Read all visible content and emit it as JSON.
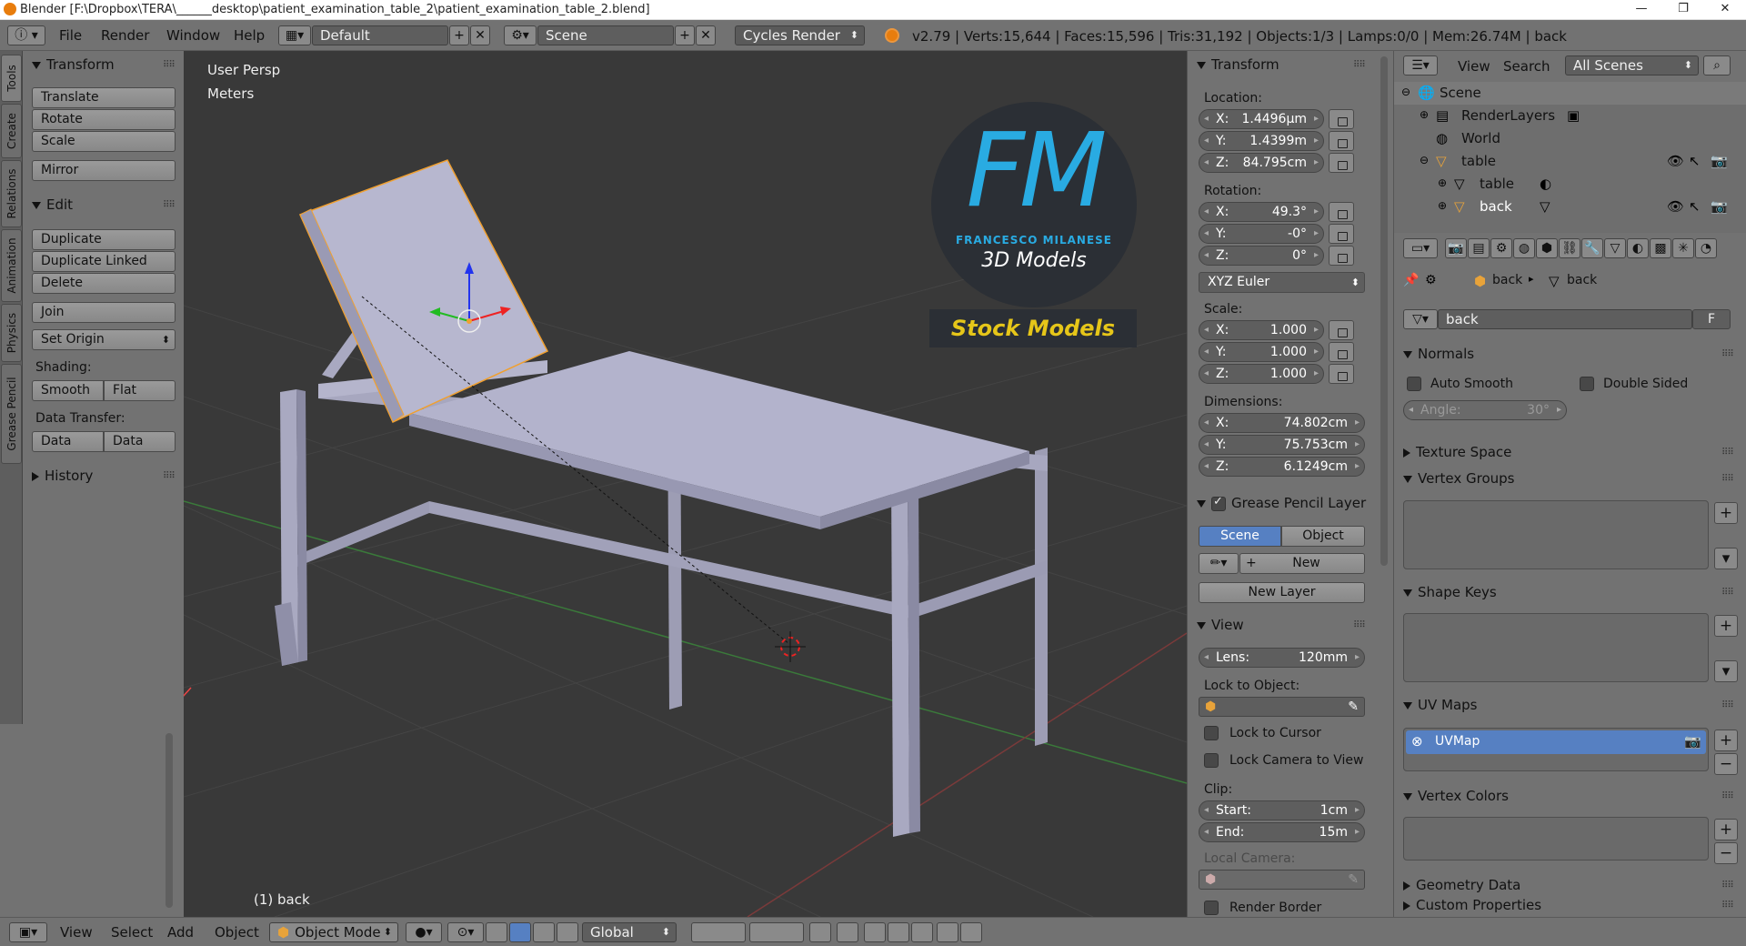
{
  "window": {
    "title": "Blender [F:\\Dropbox\\TERA\\______desktop\\patient_examination_table_2\\patient_examination_table_2.blend]"
  },
  "info": {
    "menus": [
      "File",
      "Render",
      "Window",
      "Help"
    ],
    "screen": "Default",
    "scene": "Scene",
    "engine": "Cycles Render",
    "stats": "v2.79 | Verts:15,644 | Faces:15,596 | Tris:31,192 | Objects:1/3 | Lamps:0/0 | Mem:26.74M | back"
  },
  "tabs": [
    "Tools",
    "Create",
    "Relations",
    "Animation",
    "Physics",
    "Grease Pencil"
  ],
  "toolshelf": {
    "transform_title": "Transform",
    "translate": "Translate",
    "rotate": "Rotate",
    "scale": "Scale",
    "mirror": "Mirror",
    "edit_title": "Edit",
    "duplicate": "Duplicate",
    "duplicate_linked": "Duplicate Linked",
    "delete": "Delete",
    "join": "Join",
    "set_origin": "Set Origin",
    "shading": "Shading:",
    "smooth": "Smooth",
    "flat": "Flat",
    "data_transfer": "Data Transfer:",
    "data": "Data",
    "data_layout": "Data Layo",
    "history": "History"
  },
  "viewport": {
    "view_name": "User Persp",
    "units": "Meters",
    "object_label": "(1) back",
    "watermark": {
      "letters": "FM",
      "author": "FRANCESCO MILANESE",
      "sub": "3D Models",
      "badge": "Stock Models"
    }
  },
  "npanel": {
    "transform_title": "Transform",
    "location_label": "Location:",
    "loc": [
      {
        "k": "X:",
        "v": "1.4496µm"
      },
      {
        "k": "Y:",
        "v": "1.4399m"
      },
      {
        "k": "Z:",
        "v": "84.795cm"
      }
    ],
    "rotation_label": "Rotation:",
    "rot": [
      {
        "k": "X:",
        "v": "49.3°"
      },
      {
        "k": "Y:",
        "v": "-0°"
      },
      {
        "k": "Z:",
        "v": "0°"
      }
    ],
    "rotation_mode": "XYZ Euler",
    "scale_label": "Scale:",
    "scale": [
      {
        "k": "X:",
        "v": "1.000"
      },
      {
        "k": "Y:",
        "v": "1.000"
      },
      {
        "k": "Z:",
        "v": "1.000"
      }
    ],
    "dimensions_label": "Dimensions:",
    "dim": [
      {
        "k": "X:",
        "v": "74.802cm"
      },
      {
        "k": "Y:",
        "v": "75.753cm"
      },
      {
        "k": "Z:",
        "v": "6.1249cm"
      }
    ],
    "gp_title": "Grease Pencil Layer",
    "gp_scene": "Scene",
    "gp_object": "Object",
    "gp_new": "New",
    "gp_new_layer": "New Layer",
    "view_title": "View",
    "lens_k": "Lens:",
    "lens_v": "120mm",
    "lock_to_object": "Lock to Object:",
    "lock_cursor": "Lock to Cursor",
    "lock_camera": "Lock Camera to View",
    "clip": "Clip:",
    "start_k": "Start:",
    "start_v": "1cm",
    "end_k": "End:",
    "end_v": "15m",
    "local_camera": "Local Camera:",
    "render_border": "Render Border"
  },
  "outliner": {
    "view": "View",
    "search": "Search",
    "filter": "All Scenes",
    "rows": [
      {
        "name": "Scene"
      },
      {
        "name": "RenderLayers"
      },
      {
        "name": "World"
      },
      {
        "name": "table"
      },
      {
        "name": "table"
      },
      {
        "name": "back"
      }
    ]
  },
  "props": {
    "crumb_object": "back",
    "crumb_mesh": "back",
    "mesh_name": "back",
    "fake_user": "F",
    "normals": "Normals",
    "auto_smooth": "Auto Smooth",
    "double_sided": "Double Sided",
    "angle_k": "Angle:",
    "angle_v": "30°",
    "texture_space": "Texture Space",
    "vertex_groups": "Vertex Groups",
    "shape_keys": "Shape Keys",
    "uv_maps": "UV Maps",
    "uv_item": "UVMap",
    "vertex_colors": "Vertex Colors",
    "geometry_data": "Geometry Data",
    "custom_properties": "Custom Properties"
  },
  "bottom": {
    "menus": [
      "View",
      "Select",
      "Add",
      "Object"
    ],
    "mode": "Object Mode",
    "orientation": "Global"
  },
  "colors": {
    "accent": "#5680c2",
    "selection_outline": "#f0a030",
    "watermark_blue": "#29abe2",
    "watermark_yellow": "#e6c619"
  }
}
